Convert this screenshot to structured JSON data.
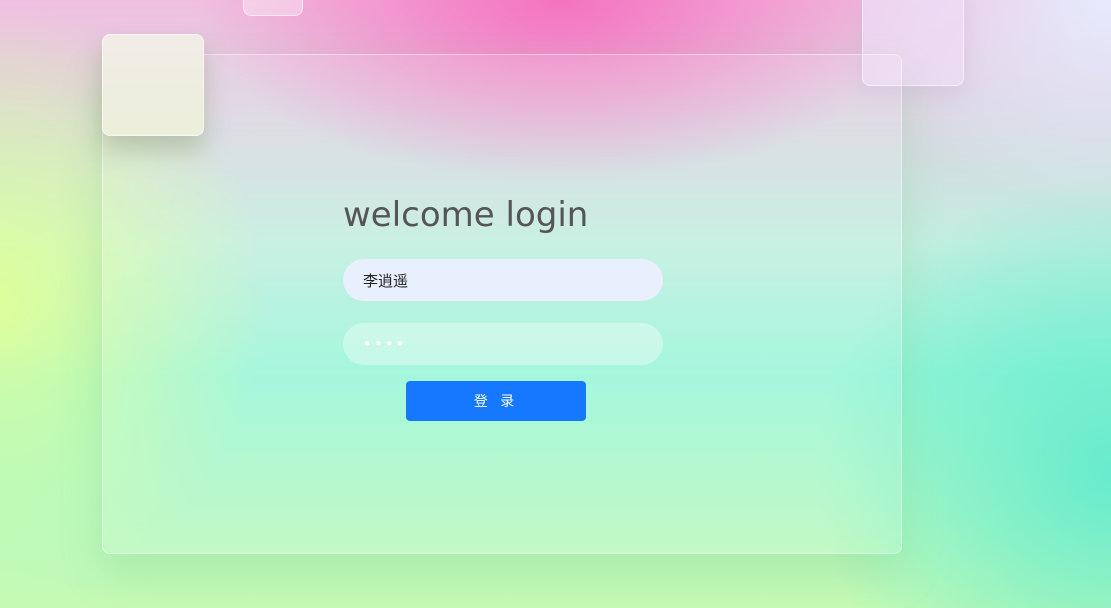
{
  "login": {
    "title": "welcome login",
    "username_value": "李逍遥",
    "password_value": "1234",
    "login_button_label": "登 录"
  },
  "colors": {
    "accent": "#1677ff",
    "title_text": "#555555",
    "username_field_bg": "#e8effd"
  }
}
